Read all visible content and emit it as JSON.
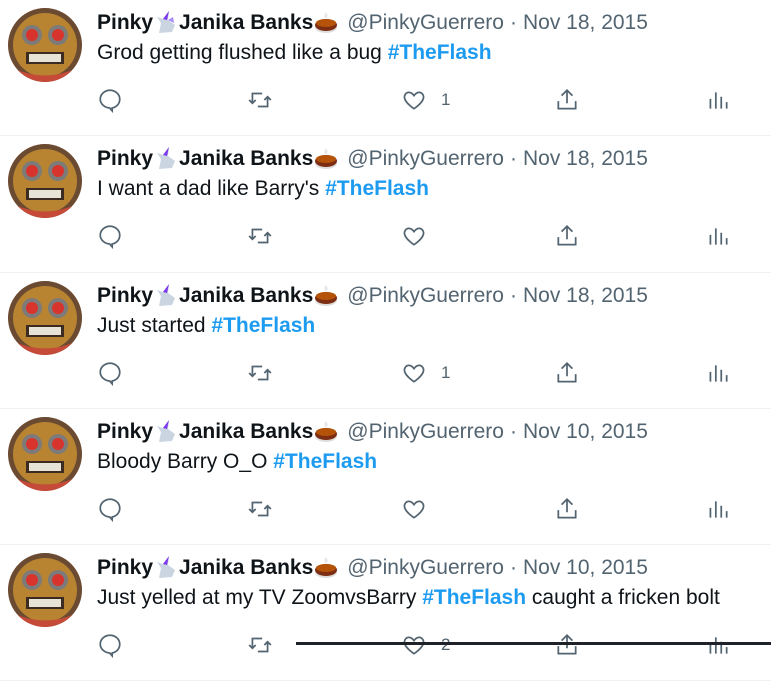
{
  "tweets": [
    {
      "name": "Pinky",
      "name2": "Janika Banks",
      "handle": "@PinkyGuerrero",
      "sep": "·",
      "date": "Nov 18, 2015",
      "text_before": "Grod getting flushed like a bug ",
      "hashtag": "#TheFlash",
      "text_after": "",
      "like_count": "1"
    },
    {
      "name": "Pinky",
      "name2": "Janika Banks",
      "handle": "@PinkyGuerrero",
      "sep": "·",
      "date": "Nov 18, 2015",
      "text_before": "I want a dad like Barry's ",
      "hashtag": "#TheFlash",
      "text_after": "",
      "like_count": ""
    },
    {
      "name": "Pinky",
      "name2": "Janika Banks",
      "handle": "@PinkyGuerrero",
      "sep": "·",
      "date": "Nov 18, 2015",
      "text_before": "Just started ",
      "hashtag": "#TheFlash",
      "text_after": "",
      "like_count": "1"
    },
    {
      "name": "Pinky",
      "name2": "Janika Banks",
      "handle": "@PinkyGuerrero",
      "sep": "·",
      "date": "Nov 10, 2015",
      "text_before": "Bloody Barry O_O ",
      "hashtag": "#TheFlash",
      "text_after": "",
      "like_count": ""
    },
    {
      "name": "Pinky",
      "name2": "Janika Banks",
      "handle": "@PinkyGuerrero",
      "sep": "·",
      "date": "Nov 10, 2015",
      "text_before": "Just yelled at my TV ZoomvsBarry ",
      "hashtag": "#TheFlash",
      "text_after": " caught a fricken bolt",
      "like_count": "2"
    }
  ],
  "icons": {
    "reply": "reply-icon",
    "retweet": "retweet-icon",
    "like": "like-icon",
    "share": "share-icon",
    "stats": "analytics-icon",
    "emoji1": "unicorn-emoji-icon",
    "emoji2": "cake-emoji-icon"
  },
  "colors": {
    "text": "#0f1419",
    "secondary": "#536471",
    "hashtag": "#1d9bf0",
    "divider": "#eff3f4"
  }
}
